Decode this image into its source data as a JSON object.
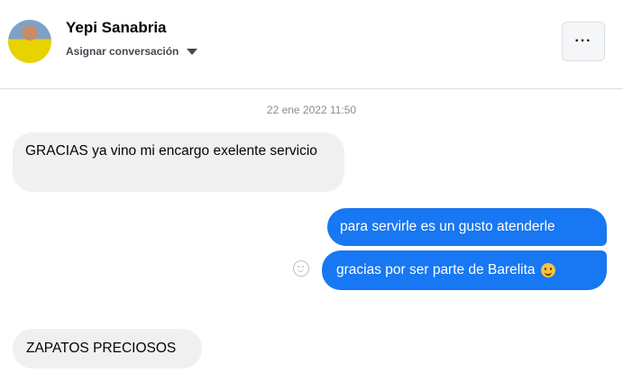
{
  "header": {
    "contact_name": "Yepi Sanabria",
    "assign_label": "Asignar conversación",
    "menu_label": "···",
    "avatar_icon": "avatar-photo"
  },
  "conversation": {
    "timestamp": "22 ene 2022 11:50",
    "messages": [
      {
        "direction": "incoming",
        "text": "GRACIAS ya vino mi encargo exelente servicio"
      },
      {
        "direction": "outgoing",
        "text": "para servirle es un gusto atenderle"
      },
      {
        "direction": "outgoing",
        "text": "gracias por ser parte de Barelita",
        "emoji": "slightly-smiling-face"
      },
      {
        "direction": "incoming",
        "text": "ZAPATOS PRECIOSOS"
      }
    ]
  },
  "colors": {
    "outgoing_bubble": "#1877f2",
    "incoming_bubble": "#f0f0f0"
  }
}
